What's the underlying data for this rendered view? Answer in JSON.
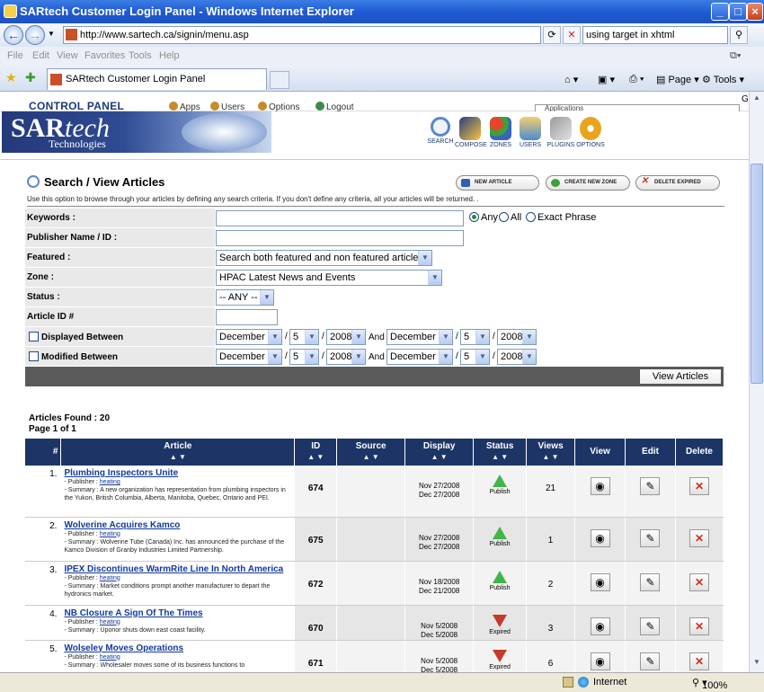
{
  "window": {
    "title": "SARtech Customer Login Panel - Windows Internet Explorer",
    "address": "http://www.sartech.ca/signin/menu.asp",
    "search_text": "using target in xhtml",
    "menu": [
      "File",
      "Edit",
      "View",
      "Favorites",
      "Tools",
      "Help"
    ],
    "tab_title": "SARtech Customer Login Panel",
    "toolbar": {
      "page": "Page",
      "tools": "Tools"
    },
    "status": {
      "zone": "Internet",
      "zoom": "100%"
    }
  },
  "control_panel": {
    "title": "CONTROL PANEL",
    "links": [
      "Apps",
      "Users",
      "Options",
      "Logout"
    ],
    "app_select": "Applications",
    "go": "Go"
  },
  "brand": {
    "name_main": "SAR",
    "name_accent": "tech",
    "sub": "Technologies"
  },
  "tools": [
    "SEARCH",
    "COMPOSE",
    "ZONES",
    "USERS",
    "PLUGINS",
    "OPTIONS"
  ],
  "section": {
    "title": "Search / View Articles",
    "buttons": [
      "NEW ARTICLE",
      "CREATE NEW ZONE",
      "DELETE EXPIRED"
    ],
    "instructions": "Use this option to browse through your articles by defining any search criteria. If you don't define any criteria, all your articles will be returned. ."
  },
  "form": {
    "keywords_label": "Keywords :",
    "keywords_value": "",
    "match_options": [
      "Any",
      "All",
      "Exact Phrase"
    ],
    "publisher_label": "Publisher Name / ID :",
    "featured_label": "Featured :",
    "featured_value": "Search both featured and non featured articles",
    "zone_label": "Zone :",
    "zone_value": "HPAC Latest News and Events",
    "status_label": "Status :",
    "status_value": "-- ANY --",
    "article_id_label": "Article ID #",
    "displayed_label": "Displayed Between",
    "modified_label": "Modified Between",
    "and_label": "And",
    "date_from": {
      "month": "December",
      "day": "5",
      "year": "2008"
    },
    "date_to": {
      "month": "December",
      "day": "5",
      "year": "2008"
    },
    "view_button": "View Articles"
  },
  "results": {
    "found": "Articles Found : 20",
    "page": "Page 1 of 1",
    "columns": [
      "#",
      "Article",
      "ID",
      "Source",
      "Display",
      "Status",
      "Views",
      "View",
      "Edit",
      "Delete"
    ],
    "sort_glyph": "▲ ▼",
    "publisher_prefix": "- Publisher :",
    "summary_prefix": "- Summary :",
    "rows": [
      {
        "num": "1.",
        "title": "Plumbing Inspectors Unite",
        "publisher": "heating",
        "summary": "A new organization has representation from plumbing inspectors in the Yukon, British Columbia, Alberta, Manitoba, Quebec, Ontario and PEI.",
        "id": "674",
        "display_from": "Nov 27/2008",
        "display_to": "Dec 27/2008",
        "status": "Publish",
        "views": "21"
      },
      {
        "num": "2.",
        "title": "Wolverine Acquires Kamco",
        "publisher": "heating",
        "summary": "Wolverine Tube (Canada) Inc. has announced the purchase of the Kamco Division of Granby Industries Limited Partnership.",
        "id": "675",
        "display_from": "Nov 27/2008",
        "display_to": "Dec 27/2008",
        "status": "Publish",
        "views": "1"
      },
      {
        "num": "3.",
        "title": "IPEX Discontinues WarmRite Line In North America",
        "publisher": "heating",
        "summary": "Market conditions prompt another manufacturer to depart the hydronics market.",
        "id": "672",
        "display_from": "Nov 18/2008",
        "display_to": "Dec 21/2008",
        "status": "Publish",
        "views": "2"
      },
      {
        "num": "4.",
        "title": "NB Closure A Sign Of The Times",
        "publisher": "heating",
        "summary": "Uponor shuts down east coast facility.",
        "id": "670",
        "display_from": "Nov 5/2008",
        "display_to": "Dec 5/2008",
        "status": "Expired",
        "views": "3"
      },
      {
        "num": "5.",
        "title": "Wolseley Moves Operations",
        "publisher": "heating",
        "summary": "Wholesaler moves some of its business functions to",
        "id": "671",
        "display_from": "Nov 5/2008",
        "display_to": "Dec 5/2008",
        "status": "Expired",
        "views": "6"
      }
    ]
  }
}
